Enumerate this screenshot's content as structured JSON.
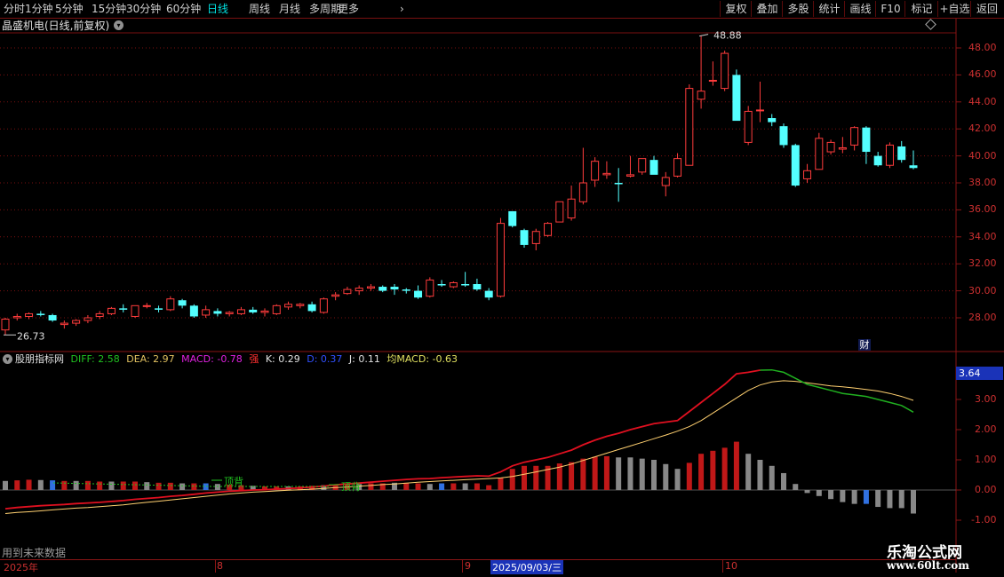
{
  "toolbar": {
    "periods": [
      "分时",
      "1分钟",
      "5分钟",
      "15分钟",
      "30分钟",
      "60分钟",
      "日线",
      "周线",
      "月线",
      "多周期",
      "更多"
    ],
    "active_period": "日线",
    "buttons": [
      "复权",
      "叠加",
      "多股",
      "统计",
      "画线",
      "F10",
      "标记",
      "+自选",
      "返回"
    ]
  },
  "stock": {
    "title": "晶盛机电(日线,前复权)"
  },
  "price_axis": [
    "48.00",
    "46.00",
    "44.00",
    "42.00",
    "40.00",
    "38.00",
    "36.00",
    "34.00",
    "32.00",
    "30.00",
    "28.00"
  ],
  "price_annotations": {
    "high": "48.88",
    "low": "26.73"
  },
  "cai_badge": "财",
  "indicator": {
    "name": "股朋指标网",
    "diff": "DIFF: 2.58",
    "dea": "DEA: 2.97",
    "macd": "MACD: -0.78",
    "signal": "强",
    "k": "K: 0.29",
    "d": "D: 0.37",
    "j": "J: 0.11",
    "avg_macd": "均MACD: -0.63",
    "current_value": "3.64",
    "axis": [
      "3.00",
      "2.00",
      "1.00",
      "0.00",
      "-1.00"
    ],
    "divergence_labels": [
      "顶背",
      "顶背"
    ]
  },
  "footer_note": "用到未来数据",
  "time_axis": {
    "labels": [
      "2025年",
      "8",
      "9",
      "2025/09/03/三",
      "10"
    ],
    "selected": "2025/09/03/三"
  },
  "watermark": {
    "line1": "乐淘公式网",
    "line2": "www.60lt.com"
  },
  "colors": {
    "up": "#ff3c3c",
    "down": "#54ffff",
    "diff": "#e01020",
    "dea": "#ffd070",
    "grid": "#7a1010"
  },
  "chart_data": {
    "type": "candlestick",
    "ohlc": [
      [
        27.1,
        28.0,
        26.73,
        27.9
      ],
      [
        28.0,
        28.3,
        27.8,
        28.1
      ],
      [
        28.1,
        28.4,
        27.9,
        28.3
      ],
      [
        28.3,
        28.5,
        28.1,
        28.2
      ],
      [
        28.2,
        28.3,
        27.7,
        27.8
      ],
      [
        27.5,
        27.8,
        27.2,
        27.6
      ],
      [
        27.6,
        27.9,
        27.4,
        27.8
      ],
      [
        27.8,
        28.2,
        27.6,
        28.0
      ],
      [
        28.1,
        28.5,
        27.9,
        28.3
      ],
      [
        28.3,
        28.8,
        28.2,
        28.7
      ],
      [
        28.7,
        29.0,
        28.4,
        28.6
      ],
      [
        28.1,
        28.9,
        28.0,
        28.9
      ],
      [
        28.9,
        29.1,
        28.7,
        28.9
      ],
      [
        28.7,
        28.9,
        28.4,
        28.6
      ],
      [
        28.6,
        29.6,
        28.5,
        29.4
      ],
      [
        29.3,
        29.4,
        28.7,
        28.9
      ],
      [
        28.9,
        29.0,
        28.0,
        28.1
      ],
      [
        28.2,
        28.9,
        28.0,
        28.6
      ],
      [
        28.5,
        28.7,
        28.1,
        28.3
      ],
      [
        28.3,
        28.5,
        28.1,
        28.4
      ],
      [
        28.3,
        28.8,
        28.2,
        28.6
      ],
      [
        28.6,
        28.8,
        28.3,
        28.4
      ],
      [
        28.4,
        28.7,
        28.1,
        28.5
      ],
      [
        28.3,
        29.0,
        28.2,
        28.9
      ],
      [
        28.8,
        29.2,
        28.6,
        29.0
      ],
      [
        28.9,
        29.1,
        28.7,
        29.0
      ],
      [
        29.0,
        29.2,
        28.4,
        28.5
      ],
      [
        28.4,
        29.5,
        28.3,
        29.4
      ],
      [
        29.6,
        29.9,
        29.3,
        29.7
      ],
      [
        29.8,
        30.3,
        29.7,
        30.1
      ],
      [
        30.0,
        30.4,
        29.7,
        30.2
      ],
      [
        30.2,
        30.5,
        30.0,
        30.3
      ],
      [
        30.3,
        30.4,
        29.9,
        30.0
      ],
      [
        30.3,
        30.5,
        29.7,
        30.1
      ],
      [
        30.1,
        30.2,
        29.8,
        30.0
      ],
      [
        30.0,
        30.4,
        29.4,
        29.5
      ],
      [
        29.6,
        31.0,
        29.5,
        30.8
      ],
      [
        30.5,
        30.8,
        30.3,
        30.4
      ],
      [
        30.3,
        30.7,
        30.2,
        30.6
      ],
      [
        30.5,
        31.4,
        30.3,
        30.4
      ],
      [
        30.5,
        30.9,
        30.0,
        30.1
      ],
      [
        30.0,
        30.2,
        29.3,
        29.5
      ],
      [
        29.6,
        35.4,
        29.5,
        35.0
      ],
      [
        35.9,
        35.9,
        34.7,
        34.8
      ],
      [
        34.5,
        34.6,
        33.2,
        33.4
      ],
      [
        33.5,
        34.6,
        33.0,
        34.4
      ],
      [
        34.1,
        35.1,
        34.0,
        35.0
      ],
      [
        35.1,
        36.6,
        35.1,
        36.6
      ],
      [
        35.4,
        37.8,
        35.2,
        36.8
      ],
      [
        36.6,
        40.6,
        36.4,
        38.0
      ],
      [
        38.2,
        39.9,
        37.7,
        39.6
      ],
      [
        38.6,
        39.6,
        38.3,
        38.7
      ],
      [
        38.0,
        39.1,
        36.6,
        37.9
      ],
      [
        38.5,
        40.0,
        38.4,
        38.6
      ],
      [
        38.8,
        39.8,
        38.6,
        39.8
      ],
      [
        39.7,
        40.0,
        38.7,
        38.6
      ],
      [
        37.8,
        38.8,
        37.0,
        38.4
      ],
      [
        38.5,
        40.2,
        38.4,
        39.8
      ],
      [
        39.3,
        45.3,
        39.3,
        45.0
      ],
      [
        44.2,
        48.88,
        43.5,
        44.8
      ],
      [
        45.6,
        47.0,
        45.2,
        45.6
      ],
      [
        45.0,
        47.8,
        44.8,
        47.6
      ],
      [
        46.0,
        46.4,
        42.7,
        42.6
      ],
      [
        41.0,
        43.7,
        40.8,
        43.3
      ],
      [
        43.4,
        45.5,
        42.5,
        43.4
      ],
      [
        42.8,
        43.1,
        42.2,
        42.5
      ],
      [
        42.2,
        42.4,
        40.6,
        40.8
      ],
      [
        40.8,
        40.9,
        37.7,
        37.8
      ],
      [
        38.3,
        39.4,
        38.0,
        38.9
      ],
      [
        39.0,
        41.7,
        39.0,
        41.3
      ],
      [
        40.3,
        41.2,
        40.1,
        41.0
      ],
      [
        40.5,
        41.4,
        40.2,
        40.6
      ],
      [
        40.8,
        42.2,
        40.4,
        42.1
      ],
      [
        42.1,
        42.2,
        39.4,
        40.3
      ],
      [
        40.0,
        40.3,
        39.2,
        39.3
      ],
      [
        39.3,
        41.0,
        39.1,
        40.8
      ],
      [
        40.7,
        41.1,
        39.5,
        39.7
      ],
      [
        39.3,
        40.4,
        39.0,
        39.1
      ]
    ],
    "ylim": [
      26.5,
      49.5
    ],
    "macd": {
      "diff": [
        -0.62,
        -0.58,
        -0.55,
        -0.52,
        -0.5,
        -0.48,
        -0.45,
        -0.43,
        -0.41,
        -0.38,
        -0.35,
        -0.31,
        -0.28,
        -0.25,
        -0.21,
        -0.18,
        -0.14,
        -0.1,
        -0.07,
        -0.04,
        -0.02,
        0.0,
        0.01,
        0.03,
        0.05,
        0.07,
        0.1,
        0.13,
        0.17,
        0.2,
        0.23,
        0.26,
        0.29,
        0.32,
        0.35,
        0.37,
        0.38,
        0.41,
        0.43,
        0.45,
        0.47,
        0.46,
        0.6,
        0.8,
        0.92,
        1.0,
        1.08,
        1.2,
        1.32,
        1.5,
        1.65,
        1.78,
        1.88,
        2.0,
        2.1,
        2.2,
        2.25,
        2.3,
        2.6,
        2.9,
        3.2,
        3.5,
        3.85,
        3.9,
        3.97,
        3.98,
        3.9,
        3.7,
        3.5,
        3.4,
        3.3,
        3.2,
        3.15,
        3.1,
        3.0,
        2.9,
        2.8,
        2.58
      ],
      "dea": [
        -0.78,
        -0.74,
        -0.72,
        -0.69,
        -0.66,
        -0.63,
        -0.6,
        -0.58,
        -0.55,
        -0.52,
        -0.49,
        -0.45,
        -0.41,
        -0.37,
        -0.33,
        -0.29,
        -0.25,
        -0.21,
        -0.17,
        -0.13,
        -0.1,
        -0.07,
        -0.05,
        -0.03,
        -0.01,
        0.01,
        0.03,
        0.05,
        0.08,
        0.1,
        0.13,
        0.15,
        0.18,
        0.2,
        0.23,
        0.26,
        0.28,
        0.3,
        0.32,
        0.34,
        0.36,
        0.38,
        0.4,
        0.45,
        0.52,
        0.6,
        0.68,
        0.76,
        0.86,
        0.98,
        1.1,
        1.22,
        1.34,
        1.46,
        1.58,
        1.7,
        1.82,
        1.95,
        2.1,
        2.3,
        2.55,
        2.8,
        3.05,
        3.3,
        3.48,
        3.58,
        3.62,
        3.6,
        3.55,
        3.5,
        3.45,
        3.42,
        3.38,
        3.33,
        3.28,
        3.2,
        3.1,
        2.97
      ],
      "hist": [
        0.3,
        0.32,
        0.34,
        0.33,
        0.32,
        0.3,
        0.3,
        0.3,
        0.28,
        0.28,
        0.28,
        0.28,
        0.26,
        0.24,
        0.24,
        0.22,
        0.22,
        0.22,
        0.2,
        0.18,
        0.16,
        0.14,
        0.12,
        0.12,
        0.12,
        0.12,
        0.14,
        0.16,
        0.18,
        0.2,
        0.2,
        0.22,
        0.22,
        0.24,
        0.24,
        0.22,
        0.2,
        0.22,
        0.22,
        0.22,
        0.22,
        0.16,
        0.4,
        0.7,
        0.8,
        0.8,
        0.8,
        0.88,
        0.92,
        1.04,
        1.1,
        1.12,
        1.08,
        1.08,
        1.04,
        1.0,
        0.86,
        0.7,
        0.9,
        1.2,
        1.3,
        1.4,
        1.6,
        1.2,
        1.0,
        0.8,
        0.56,
        0.2,
        -0.1,
        -0.2,
        -0.3,
        -0.4,
        -0.46,
        -0.46,
        -0.56,
        -0.6,
        -0.6,
        -0.78
      ]
    }
  }
}
